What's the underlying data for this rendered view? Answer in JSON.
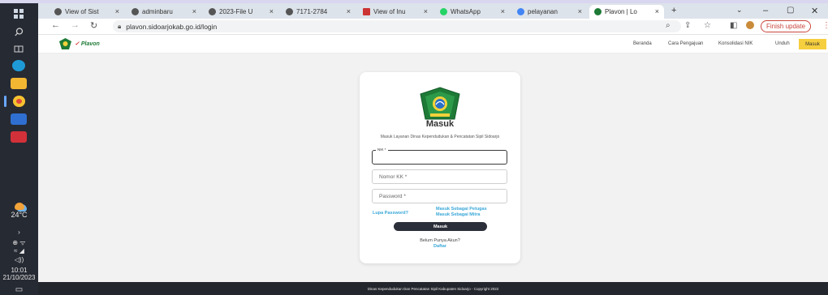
{
  "browser": {
    "tabs": [
      {
        "label": "View of Sist"
      },
      {
        "label": "adminbaru"
      },
      {
        "label": "2023-File U"
      },
      {
        "label": "7171-2784"
      },
      {
        "label": "View of Inu"
      },
      {
        "label": "WhatsApp"
      },
      {
        "label": "pelayanan"
      },
      {
        "label": "Plavon | Lo"
      }
    ],
    "new_tab": "+",
    "url": "plavon.sidoarjokab.go.id/login",
    "finish_update": "Finish update"
  },
  "taskbar": {
    "weather_temp": "24°C",
    "time": "10:01",
    "date": "21/10/2023"
  },
  "site": {
    "logo_text": "Plavon",
    "nav": [
      "Beranda",
      "Cara Pengajuan",
      "Konsolidasi NIK",
      "Unduh"
    ],
    "login_button": "Masuk"
  },
  "login": {
    "title": "Masuk",
    "subtitle": "Masuk Layanan Dinas Kependudukan & Pencatatan Sipil Sidoarjo",
    "nik_label": "NIK *",
    "kk_placeholder": "Nomor KK *",
    "password_placeholder": "Password *",
    "forgot": "Lupa Password?",
    "as_officer": "Masuk Sebagai Petugas",
    "as_partner": "Masuk Sebagai Mitra",
    "submit": "Masuk",
    "no_account": "Belum Punya Akun?",
    "register": "Daftar"
  },
  "footer": {
    "text": "Dinas Kependudukan Dan Pencatatan Sipil Kabupaten Sidoarjo - Copyright 2022"
  },
  "colors": {
    "accent": "#3aa7d8",
    "button_dark": "#2b2f3a",
    "nav_highlight": "#f6cf3e"
  }
}
